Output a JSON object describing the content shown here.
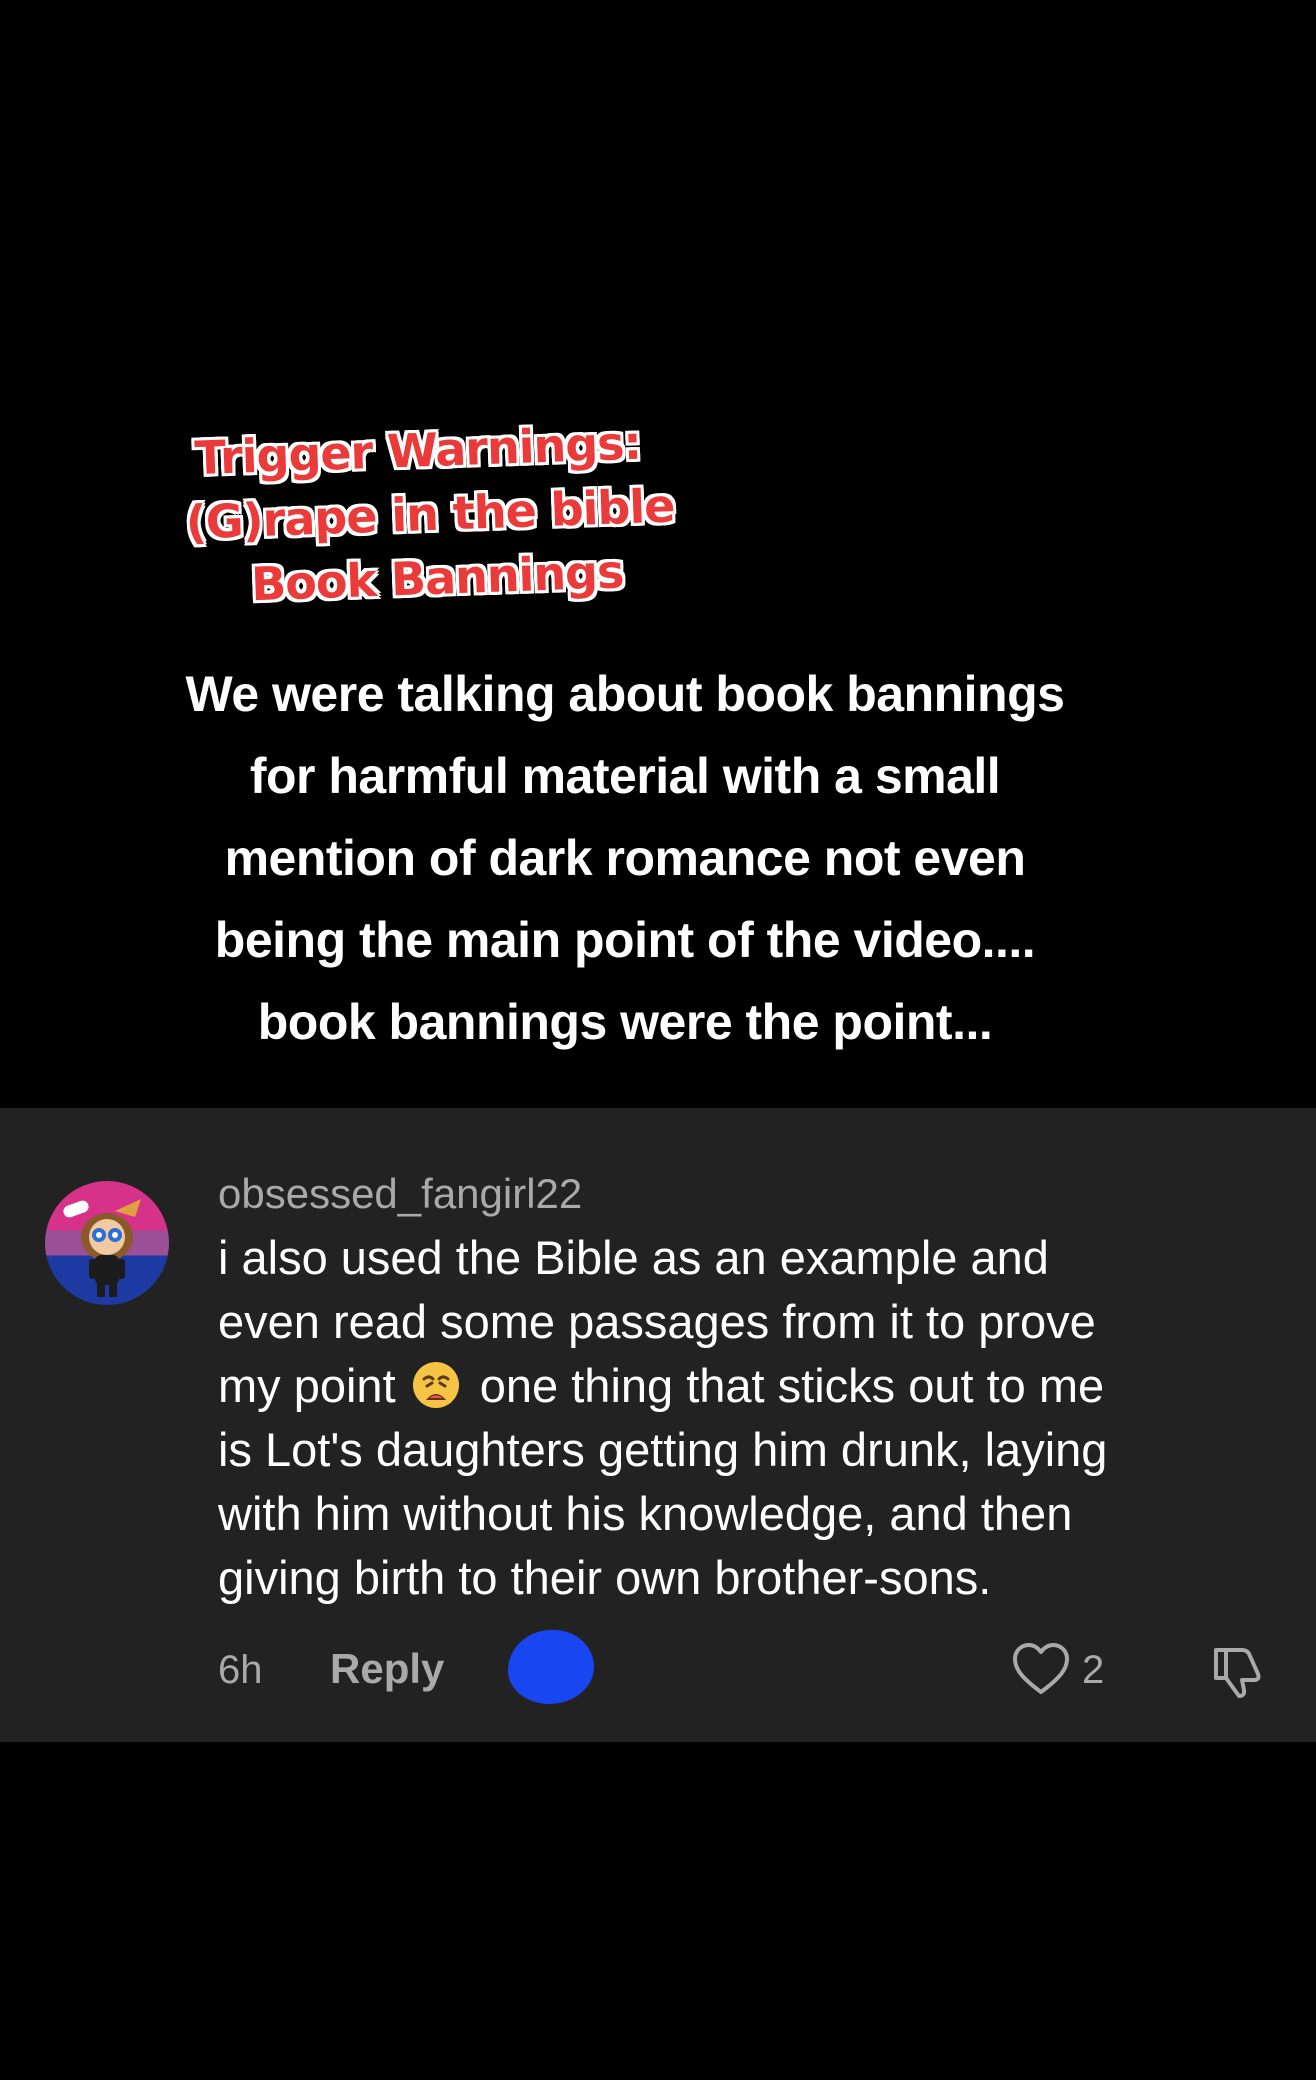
{
  "video_overlay": {
    "trigger_warnings": [
      "Trigger Warnings:",
      "(G)rape in the bible",
      "Book Bannings"
    ],
    "caption_lines": [
      "We were talking about book bannings",
      "for harmful material with a small",
      "mention of dark romance not even",
      "being the main point of the video....",
      "book bannings were the point..."
    ]
  },
  "comment": {
    "username": "obsessed_fangirl22",
    "text_lines": [
      "i also used the Bible as an example and",
      "even read some passages from it to prove",
      "my point",
      "one thing that sticks out to me",
      "is Lot's daughters getting him drunk, laying",
      "with him without his knowledge, and then",
      "giving birth to their own brother-sons."
    ],
    "emoji": "weary-face-emoji",
    "timestamp": "6h",
    "reply_label": "Reply",
    "like_count": "2",
    "icons": {
      "like": "heart-icon",
      "dislike": "thumbs-down-icon"
    },
    "colors": {
      "card_background": "#222222",
      "muted_text": "#a9a9a9",
      "redaction": "#1846f0",
      "warning_text": "#ea3a3a"
    }
  }
}
